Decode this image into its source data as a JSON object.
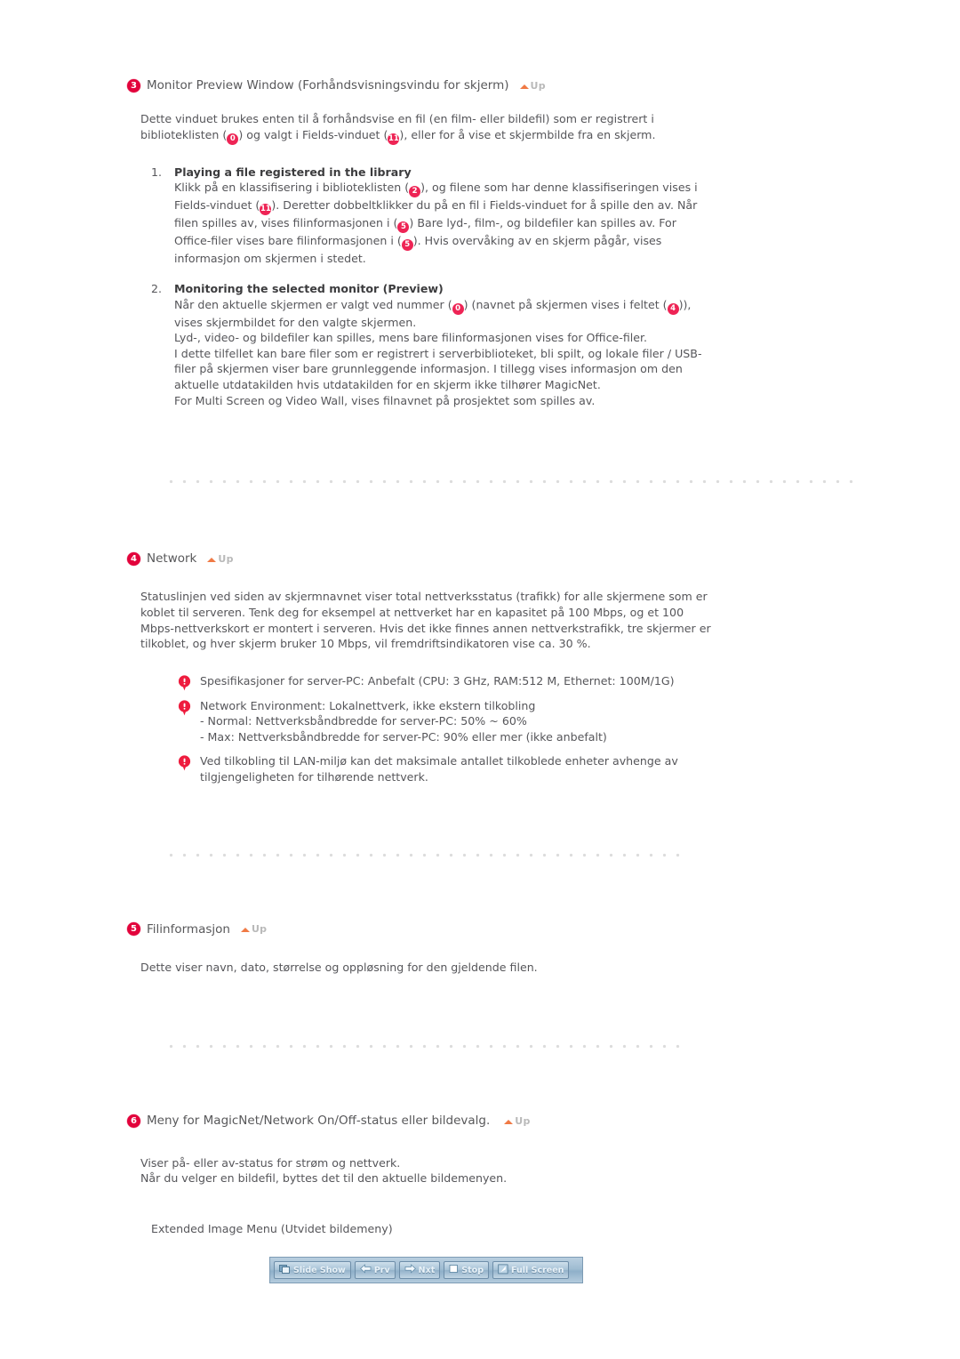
{
  "document": {
    "language": "Norwegian",
    "up_label": "Up"
  },
  "sections": [
    {
      "number": "3",
      "title": "Monitor Preview Window (Forhåndsvisningsvindu for skjerm)",
      "intro": "Dette vinduet brukes enten til å forhåndsvise en fil (en film- eller bildefil) som er registrert i biblioteklisten (①) og valgt i Fields-vinduet (②), eller for å vise et skjermbilde fra en skjerm.",
      "intro_parts": {
        "a": "Dette vinduet brukes enten til å forhåndsvise en fil (en film- eller bildefil) som er registrert i biblioteklisten (",
        "ref1": "0",
        "b": ") og valgt i Fields-vinduet (",
        "ref2": "11",
        "c": "), eller for å vise et skjermbilde fra en skjerm."
      },
      "list": [
        {
          "index": "1.",
          "title": "Playing a file registered in the library",
          "parts": {
            "a": "Klikk på en klassifisering i biblioteklisten (",
            "r1": "2",
            "b": "), og filene som har denne klassifiseringen vises i Fields-vinduet (",
            "r2": "11",
            "c": "). Deretter dobbeltklikker du på en fil i Fields-vinduet for å spille den av. Når filen spilles av, vises filinformasjonen i (",
            "r3": "5",
            "d": ") Bare lyd-, film-, og bildefiler kan spilles av. For Office-filer vises bare filinformasjonen i (",
            "r4": "5",
            "e": "). Hvis overvåking av en skjerm pågår, vises informasjon om skjermen i stedet."
          }
        },
        {
          "index": "2.",
          "title": "Monitoring the selected monitor (Preview)",
          "parts": {
            "a": "Når den aktuelle skjermen er valgt ved nummer (",
            "r1": "0",
            "b": ") (navnet på skjermen vises i feltet (",
            "r2": "4",
            "c": ")), vises skjermbildet for den valgte skjermen.",
            "lines": [
              "Lyd-, video- og bildefiler kan spilles, mens bare filinformasjonen vises for Office-filer.",
              "I dette tilfellet kan bare filer som er registrert i serverbiblioteket, bli spilt, og lokale filer / USB-filer på skjermen viser bare grunnleggende informasjon. I tillegg vises informasjon om den aktuelle utdatakilden hvis utdatakilden for en skjerm ikke tilhører MagicNet.",
              "For Multi Screen og Video Wall, vises filnavnet på prosjektet som spilles av."
            ]
          }
        }
      ]
    },
    {
      "number": "4",
      "title": "Network",
      "intro": "Statuslinjen ved siden av skjermnavnet viser total nettverksstatus (trafikk) for alle skjermene som er koblet til serveren. Tenk deg for eksempel at nettverket har en kapasitet på 100 Mbps, og et 100 Mbps-nettverkskort er montert i serveren. Hvis det ikke finnes annen nettverkstrafikk, tre skjermer er tilkoblet, og hver skjerm bruker 10 Mbps, vil fremdriftsindikatoren vise ca. 30 %.",
      "notes": [
        "Spesifikasjoner for server-PC: Anbefalt (CPU: 3 GHz, RAM:512 M, Ethernet: 100M/1G)",
        "Network Environment: Lokalnettverk, ikke ekstern tilkobling\n- Normal: Nettverksbåndbredde for server-PC: 50% ~ 60%\n- Max: Nettverksbåndbredde for server-PC: 90% eller mer (ikke anbefalt)",
        "Ved tilkobling til LAN-miljø kan det maksimale antallet tilkoblede enheter avhenge av tilgjengeligheten for tilhørende nettverk."
      ],
      "notes_lines": {
        "note2_line1": "Network Environment: Lokalnettverk, ikke ekstern tilkobling",
        "note2_line2": "- Normal: Nettverksbåndbredde for server-PC: 50% ~ 60%",
        "note2_line3": "- Max: Nettverksbåndbredde for server-PC: 90% eller mer (ikke anbefalt)"
      }
    },
    {
      "number": "5",
      "title": "Filinformasjon",
      "intro": "Dette viser navn, dato, størrelse og oppløsning for den gjeldende filen."
    },
    {
      "number": "6",
      "title": "Meny for MagicNet/Network On/Off-status eller bildevalg.",
      "intro_line1": "Viser på- eller av-status for strøm og nettverk.",
      "intro_line2": "Når du velger en bildefil, byttes det til den aktuelle bildemenyen.",
      "caption": "Extended Image Menu (Utvidet bildemeny)"
    }
  ],
  "toolbar": {
    "buttons": [
      {
        "label": "Slide Show",
        "icon": "slideshow-icon"
      },
      {
        "label": "Prv",
        "icon": "arrow-left-icon"
      },
      {
        "label": "Nxt",
        "icon": "arrow-right-icon"
      },
      {
        "label": "Stop",
        "icon": "stop-square-icon"
      },
      {
        "label": "Full Screen",
        "icon": "fullscreen-icon"
      }
    ]
  },
  "colors": {
    "badge_red": "#e2033b",
    "inline_red": "#ee2455",
    "up_arrow_orange": "#f07a45",
    "up_text_gray": "#b9b9b9",
    "body_text": "#56565a",
    "separator_dot": "#dcdcdc",
    "toolbar_blue": "#9fbcd2"
  }
}
